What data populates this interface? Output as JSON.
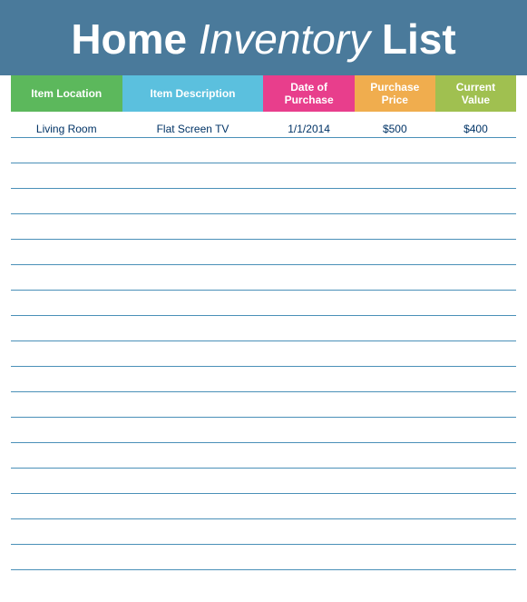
{
  "header": {
    "title_part1": "Home",
    "title_part2": "Inventory",
    "title_part3": "List"
  },
  "columns": [
    {
      "id": "location",
      "label": "Item Location",
      "class": "col-location"
    },
    {
      "id": "description",
      "label": "Item Description",
      "class": "col-description"
    },
    {
      "id": "date",
      "label": "Date of Purchase",
      "class": "col-date"
    },
    {
      "id": "purchase_price",
      "label": "Purchase Price",
      "class": "col-purchase"
    },
    {
      "id": "current_value",
      "label": "Current Value",
      "class": "col-current"
    }
  ],
  "rows": [
    {
      "location": "Living Room",
      "description": "Flat Screen TV",
      "date": "1/1/2014",
      "purchase_price": "$500",
      "current_value": "$400"
    },
    {
      "location": "",
      "description": "",
      "date": "",
      "purchase_price": "",
      "current_value": ""
    },
    {
      "location": "",
      "description": "",
      "date": "",
      "purchase_price": "",
      "current_value": ""
    },
    {
      "location": "",
      "description": "",
      "date": "",
      "purchase_price": "",
      "current_value": ""
    },
    {
      "location": "",
      "description": "",
      "date": "",
      "purchase_price": "",
      "current_value": ""
    },
    {
      "location": "",
      "description": "",
      "date": "",
      "purchase_price": "",
      "current_value": ""
    },
    {
      "location": "",
      "description": "",
      "date": "",
      "purchase_price": "",
      "current_value": ""
    },
    {
      "location": "",
      "description": "",
      "date": "",
      "purchase_price": "",
      "current_value": ""
    },
    {
      "location": "",
      "description": "",
      "date": "",
      "purchase_price": "",
      "current_value": ""
    },
    {
      "location": "",
      "description": "",
      "date": "",
      "purchase_price": "",
      "current_value": ""
    },
    {
      "location": "",
      "description": "",
      "date": "",
      "purchase_price": "",
      "current_value": ""
    },
    {
      "location": "",
      "description": "",
      "date": "",
      "purchase_price": "",
      "current_value": ""
    },
    {
      "location": "",
      "description": "",
      "date": "",
      "purchase_price": "",
      "current_value": ""
    },
    {
      "location": "",
      "description": "",
      "date": "",
      "purchase_price": "",
      "current_value": ""
    },
    {
      "location": "",
      "description": "",
      "date": "",
      "purchase_price": "",
      "current_value": ""
    },
    {
      "location": "",
      "description": "",
      "date": "",
      "purchase_price": "",
      "current_value": ""
    },
    {
      "location": "",
      "description": "",
      "date": "",
      "purchase_price": "",
      "current_value": ""
    },
    {
      "location": "",
      "description": "",
      "date": "",
      "purchase_price": "",
      "current_value": ""
    }
  ]
}
